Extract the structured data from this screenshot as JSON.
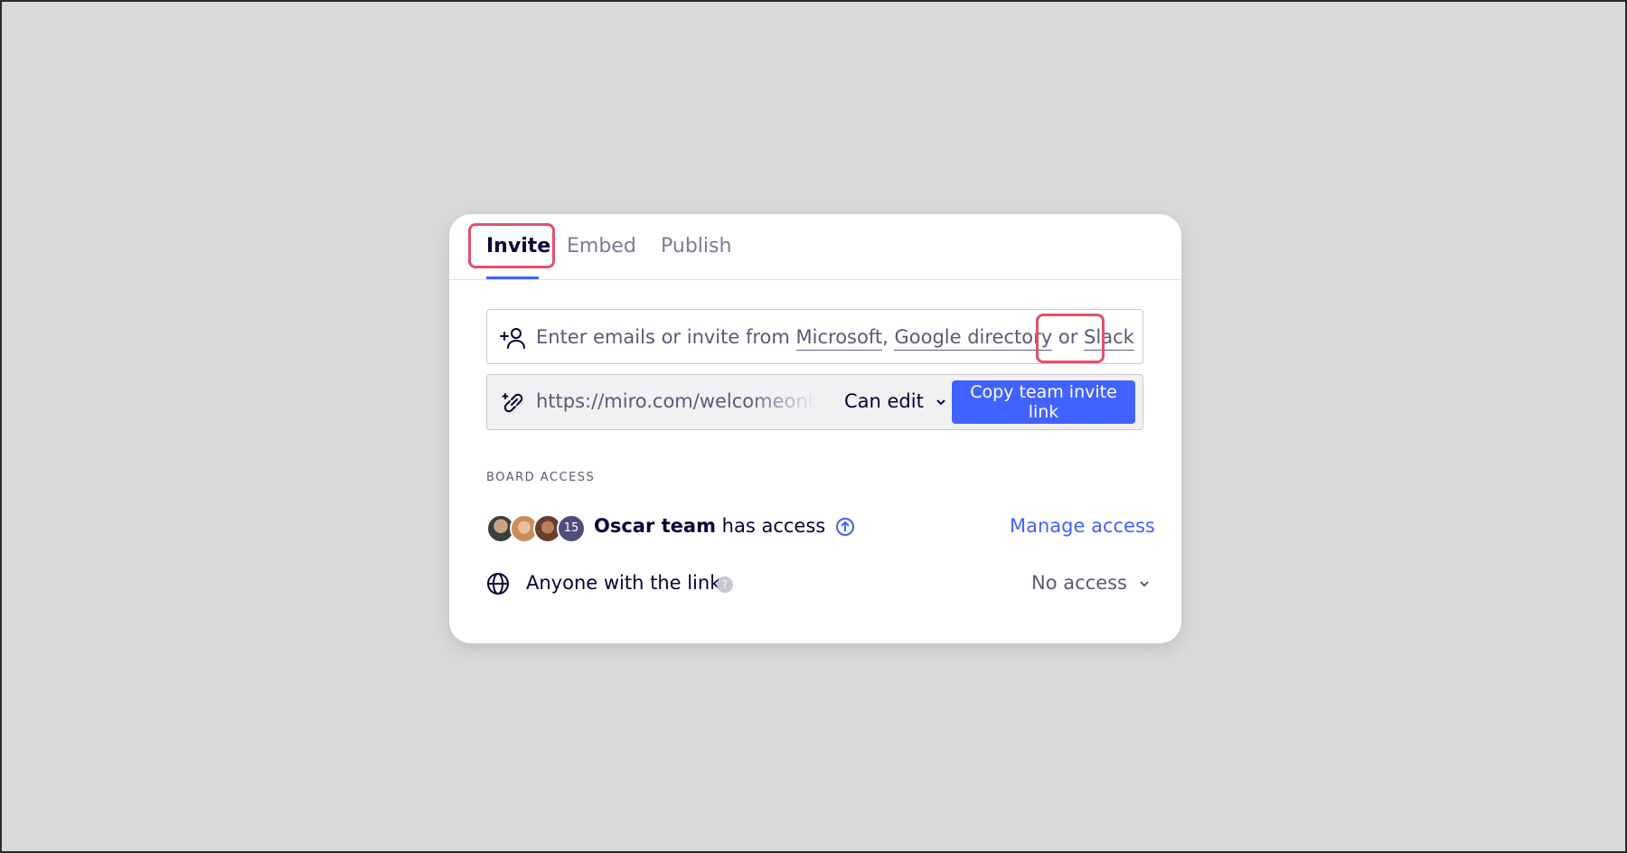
{
  "tabs": [
    {
      "label": "Invite",
      "active": true
    },
    {
      "label": "Embed",
      "active": false
    },
    {
      "label": "Publish",
      "active": false
    }
  ],
  "invite": {
    "prefix": "Enter emails or invite from",
    "microsoft": "Microsoft",
    "comma": ",",
    "google": "Google directory",
    "or": "or",
    "slack": "Slack",
    "icon": "add-user-icon"
  },
  "link": {
    "url": "https://miro.com/welcomeonboard",
    "permission": "Can edit",
    "copy_label": "Copy team invite link",
    "icon": "link-plus-icon"
  },
  "board_access": {
    "section_label": "BOARD ACCESS",
    "team_count": "15",
    "team_name": "Oscar team",
    "team_suffix": "has access",
    "manage_label": "Manage access",
    "anyone_label": "Anyone with the link",
    "help": "?",
    "no_access_label": "No access"
  },
  "colors": {
    "accent": "#4262ff",
    "highlight": "#e0526a",
    "background": "#d9d9d9"
  }
}
